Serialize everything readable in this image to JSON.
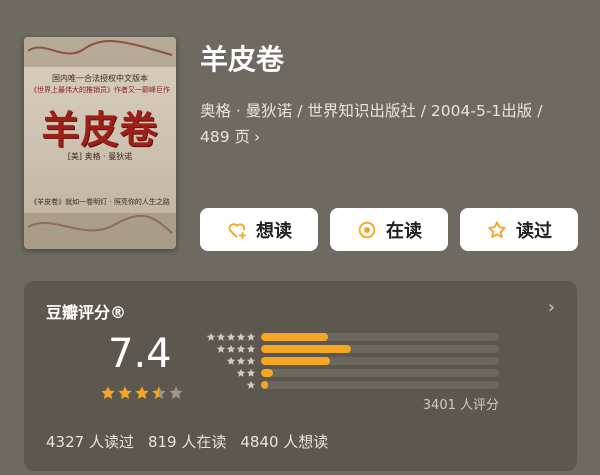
{
  "book": {
    "title": "羊皮卷",
    "meta_line1": "奥格 · 曼狄诺 / 世界知识出版社 / 2004-5-1出版 /",
    "meta_line2": "489 页",
    "cover": {
      "line1": "国内唯一合法授权中文版本",
      "line2": "《世界上最伟大的推销员》作者又一巅峰巨作",
      "title": "羊皮卷",
      "author": "[美] 奥格 · 曼狄诺",
      "tagline": "《羊皮卷》就如一卷明灯 · 照亮你的人生之路"
    }
  },
  "actions": [
    {
      "label": "想读",
      "icon": "heart-plus-icon"
    },
    {
      "label": "在读",
      "icon": "target-circle-icon"
    },
    {
      "label": "读过",
      "icon": "star-outline-icon"
    }
  ],
  "rating": {
    "title": "豆瓣评分®",
    "score": "7.4",
    "stars_value": 3.5,
    "count_text": "3401 人评分",
    "distribution": [
      {
        "stars": 5,
        "fraction": 0.28
      },
      {
        "stars": 4,
        "fraction": 0.38
      },
      {
        "stars": 3,
        "fraction": 0.29
      },
      {
        "stars": 2,
        "fraction": 0.05
      },
      {
        "stars": 1,
        "fraction": 0.03
      }
    ],
    "stats": [
      "4327 人读过",
      "819 人在读",
      "4840 人想读"
    ]
  },
  "colors": {
    "accent": "#f5a623",
    "background": "#6e6a62",
    "card": "#5c5850"
  }
}
